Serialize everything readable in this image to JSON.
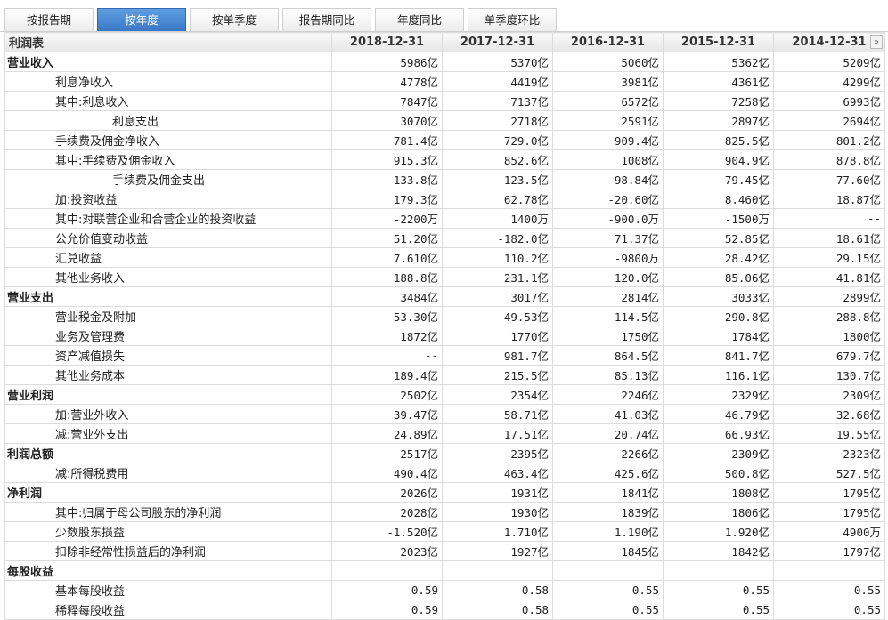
{
  "tabs": [
    {
      "label": "按报告期",
      "active": false
    },
    {
      "label": "按年度",
      "active": true
    },
    {
      "label": "按单季度",
      "active": false
    },
    {
      "label": "报告期同比",
      "active": false
    },
    {
      "label": "年度同比",
      "active": false
    },
    {
      "label": "单季度环比",
      "active": false
    }
  ],
  "table": {
    "title": "利润表",
    "columns": [
      "2018-12-31",
      "2017-12-31",
      "2016-12-31",
      "2015-12-31",
      "2014-12-31"
    ],
    "scroll_icon": "double-chevron-right-icon",
    "scroll_glyph": "»",
    "rows": [
      {
        "label": "营业收入",
        "level": 0,
        "values": [
          "5986亿",
          "5370亿",
          "5060亿",
          "5362亿",
          "5209亿"
        ]
      },
      {
        "label": "利息净收入",
        "level": 1,
        "values": [
          "4778亿",
          "4419亿",
          "3981亿",
          "4361亿",
          "4299亿"
        ]
      },
      {
        "label": "其中:利息收入",
        "level": 1,
        "values": [
          "7847亿",
          "7137亿",
          "6572亿",
          "7258亿",
          "6993亿"
        ]
      },
      {
        "label": "利息支出",
        "level": 2,
        "values": [
          "3070亿",
          "2718亿",
          "2591亿",
          "2897亿",
          "2694亿"
        ]
      },
      {
        "label": "手续费及佣金净收入",
        "level": 1,
        "values": [
          "781.4亿",
          "729.0亿",
          "909.4亿",
          "825.5亿",
          "801.2亿"
        ]
      },
      {
        "label": "其中:手续费及佣金收入",
        "level": 1,
        "values": [
          "915.3亿",
          "852.6亿",
          "1008亿",
          "904.9亿",
          "878.8亿"
        ]
      },
      {
        "label": "手续费及佣金支出",
        "level": 2,
        "values": [
          "133.8亿",
          "123.5亿",
          "98.84亿",
          "79.45亿",
          "77.60亿"
        ]
      },
      {
        "label": "加:投资收益",
        "level": 1,
        "values": [
          "179.3亿",
          "62.78亿",
          "-20.60亿",
          "8.460亿",
          "18.87亿"
        ]
      },
      {
        "label": "其中:对联营企业和合营企业的投资收益",
        "level": 1,
        "values": [
          "-2200万",
          "1400万",
          "-900.0万",
          "-1500万",
          "--"
        ]
      },
      {
        "label": "公允价值变动收益",
        "level": 1,
        "values": [
          "51.20亿",
          "-182.0亿",
          "71.37亿",
          "52.85亿",
          "18.61亿"
        ]
      },
      {
        "label": "汇兑收益",
        "level": 1,
        "values": [
          "7.610亿",
          "110.2亿",
          "-9800万",
          "28.42亿",
          "29.15亿"
        ]
      },
      {
        "label": "其他业务收入",
        "level": 1,
        "values": [
          "188.8亿",
          "231.1亿",
          "120.0亿",
          "85.06亿",
          "41.81亿"
        ]
      },
      {
        "label": "营业支出",
        "level": 0,
        "values": [
          "3484亿",
          "3017亿",
          "2814亿",
          "3033亿",
          "2899亿"
        ]
      },
      {
        "label": "营业税金及附加",
        "level": 1,
        "values": [
          "53.30亿",
          "49.53亿",
          "114.5亿",
          "290.8亿",
          "288.8亿"
        ]
      },
      {
        "label": "业务及管理费",
        "level": 1,
        "values": [
          "1872亿",
          "1770亿",
          "1750亿",
          "1784亿",
          "1800亿"
        ]
      },
      {
        "label": "资产减值损失",
        "level": 1,
        "values": [
          "--",
          "981.7亿",
          "864.5亿",
          "841.7亿",
          "679.7亿"
        ]
      },
      {
        "label": "其他业务成本",
        "level": 1,
        "values": [
          "189.4亿",
          "215.5亿",
          "85.13亿",
          "116.1亿",
          "130.7亿"
        ]
      },
      {
        "label": "营业利润",
        "level": 0,
        "values": [
          "2502亿",
          "2354亿",
          "2246亿",
          "2329亿",
          "2309亿"
        ]
      },
      {
        "label": "加:营业外收入",
        "level": 1,
        "values": [
          "39.47亿",
          "58.71亿",
          "41.03亿",
          "46.79亿",
          "32.68亿"
        ]
      },
      {
        "label": "减:营业外支出",
        "level": 1,
        "values": [
          "24.89亿",
          "17.51亿",
          "20.74亿",
          "66.93亿",
          "19.55亿"
        ]
      },
      {
        "label": "利润总额",
        "level": 0,
        "values": [
          "2517亿",
          "2395亿",
          "2266亿",
          "2309亿",
          "2323亿"
        ]
      },
      {
        "label": "减:所得税费用",
        "level": 1,
        "values": [
          "490.4亿",
          "463.4亿",
          "425.6亿",
          "500.8亿",
          "527.5亿"
        ]
      },
      {
        "label": "净利润",
        "level": 0,
        "values": [
          "2026亿",
          "1931亿",
          "1841亿",
          "1808亿",
          "1795亿"
        ]
      },
      {
        "label": "其中:归属于母公司股东的净利润",
        "level": 1,
        "values": [
          "2028亿",
          "1930亿",
          "1839亿",
          "1806亿",
          "1795亿"
        ]
      },
      {
        "label": "少数股东损益",
        "level": 1,
        "values": [
          "-1.520亿",
          "1.710亿",
          "1.190亿",
          "1.920亿",
          "4900万"
        ]
      },
      {
        "label": "扣除非经常性损益后的净利润",
        "level": 1,
        "values": [
          "2023亿",
          "1927亿",
          "1845亿",
          "1842亿",
          "1797亿"
        ]
      },
      {
        "label": "每股收益",
        "level": 0,
        "values": [
          "",
          "",
          "",
          "",
          ""
        ]
      },
      {
        "label": "基本每股收益",
        "level": 1,
        "values": [
          "0.59",
          "0.58",
          "0.55",
          "0.55",
          "0.55"
        ]
      },
      {
        "label": "稀释每股收益",
        "level": 1,
        "values": [
          "0.59",
          "0.58",
          "0.55",
          "0.55",
          "0.55"
        ]
      }
    ]
  }
}
